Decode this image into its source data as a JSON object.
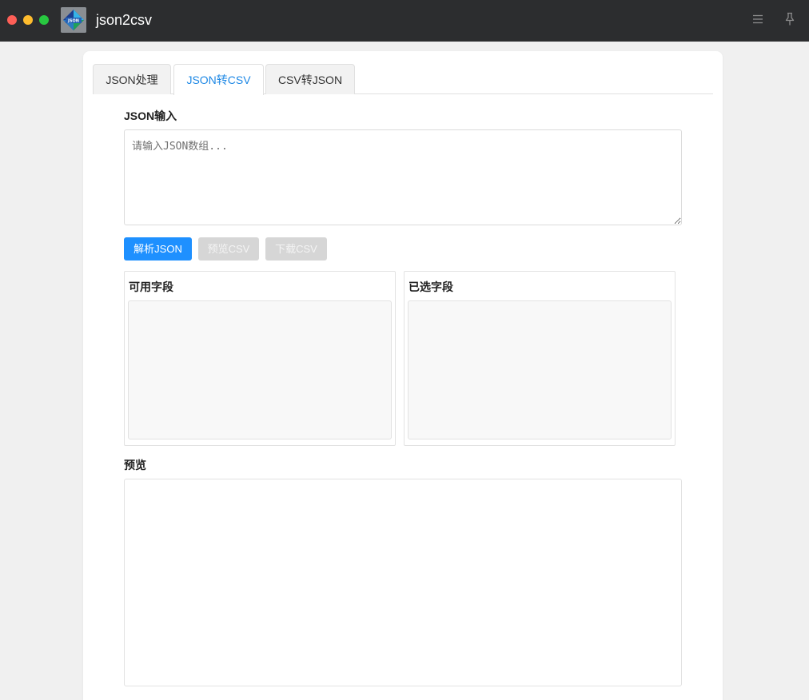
{
  "window": {
    "title": "json2csv",
    "controls": {
      "close_color": "#fe5f57",
      "minimize_color": "#febc2e",
      "maximize_color": "#28c840"
    },
    "app_icon": {
      "text_top": "JSON",
      "text_bottom": "CSV"
    },
    "menu_icon": "hamburger-icon",
    "pin_icon": "pin-icon"
  },
  "tabs": [
    {
      "label": "JSON处理",
      "active": false
    },
    {
      "label": "JSON转CSV",
      "active": true
    },
    {
      "label": "CSV转JSON",
      "active": false
    }
  ],
  "json_input": {
    "label": "JSON输入",
    "placeholder": "请输入JSON数组...",
    "value": ""
  },
  "actions": {
    "parse_label": "解析JSON",
    "preview_label": "预览CSV",
    "download_label": "下载CSV"
  },
  "fields": {
    "available_label": "可用字段",
    "available": [],
    "selected_label": "已选字段",
    "selected": []
  },
  "preview": {
    "label": "预览",
    "content": ""
  },
  "colors": {
    "accent": "#1e90ff",
    "active_tab_text": "#1e88e5",
    "disabled_button": "#d6d6d6",
    "titlebar": "#2c2d2f"
  }
}
